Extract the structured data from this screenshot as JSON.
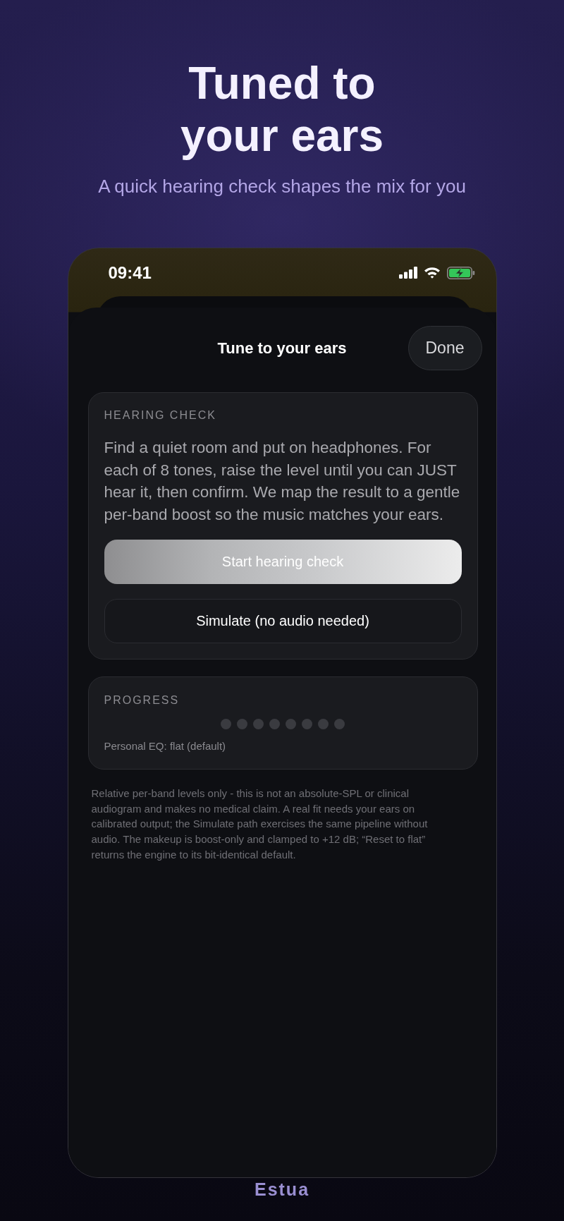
{
  "header": {
    "title": "Tuned to your ears",
    "subtitle": "A quick hearing check shapes the mix for you"
  },
  "status_bar": {
    "time": "09:41"
  },
  "sheet": {
    "title": "Tune to your ears",
    "done_button": "Done"
  },
  "hearing_check": {
    "label": "HEARING CHECK",
    "text": "Find a quiet room and put on headphones. For each of 8 tones, raise the level until you can JUST hear it, then confirm. We map the result to a gentle per-band boost so the music matches your ears.",
    "buttons": [
      {
        "label": "Start hearing check",
        "kind": "primary"
      },
      {
        "label": "Simulate (no audio needed)",
        "kind": "secondary"
      }
    ]
  },
  "progress": {
    "label": "PROGRESS",
    "steps": [
      {
        "done": false
      },
      {
        "done": false
      },
      {
        "done": false
      },
      {
        "done": false
      },
      {
        "done": false
      },
      {
        "done": false
      },
      {
        "done": false
      },
      {
        "done": false
      }
    ],
    "status": "Personal EQ: flat (default)"
  },
  "disclaimer": "Relative per-band levels only - this is not an absolute-SPL or clinical audiogram and makes no medical claim. A real fit needs your ears on calibrated output; the Simulate path exercises the same pipeline without audio. The makeup is boost-only and clamped to +12 dB; “Reset to flat” returns the engine to its bit-identical default.",
  "footer": {
    "brand": "Estua"
  }
}
